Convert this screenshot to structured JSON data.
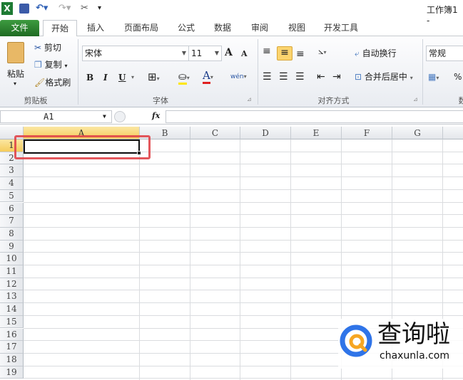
{
  "window": {
    "title": "工作簿1 -"
  },
  "quick_access": {
    "icons": [
      "excel-logo-icon",
      "save-icon",
      "undo-icon",
      "redo-icon",
      "customize-tools-icon",
      "customize-dropdown-icon"
    ]
  },
  "tabs": [
    {
      "label": "文件"
    },
    {
      "label": "开始",
      "active": true
    },
    {
      "label": "插入"
    },
    {
      "label": "页面布局"
    },
    {
      "label": "公式"
    },
    {
      "label": "数据"
    },
    {
      "label": "审阅"
    },
    {
      "label": "视图"
    },
    {
      "label": "开发工具"
    }
  ],
  "ribbon": {
    "clipboard": {
      "label": "剪贴板",
      "paste": "粘贴",
      "cut": "剪切",
      "copy": "复制",
      "format_painter": "格式刷"
    },
    "font": {
      "label": "字体",
      "font_name": "宋体",
      "font_size": "11",
      "bold": "B",
      "italic": "I",
      "underline": "U",
      "font_color": "A",
      "phonetic": "wén",
      "grow": "A",
      "shrink": "A"
    },
    "alignment": {
      "label": "对齐方式",
      "wrap_text": "自动换行",
      "merge_center": "合并后居中"
    },
    "number": {
      "label": "数",
      "format": "常规",
      "percent": "%"
    }
  },
  "formula_bar": {
    "name_box": "A1",
    "fx": "fx",
    "value": ""
  },
  "grid": {
    "columns": [
      "A",
      "B",
      "C",
      "D",
      "E",
      "F",
      "G"
    ],
    "rows": [
      "1",
      "2",
      "3",
      "4",
      "5",
      "6",
      "7",
      "8",
      "9",
      "10",
      "11",
      "12",
      "13",
      "14",
      "15",
      "16",
      "17",
      "18",
      "19"
    ],
    "active_cell": "A1"
  },
  "highlight_color": "#e0454a",
  "watermark": {
    "name": "查询啦",
    "url": "chaxunla.com"
  }
}
